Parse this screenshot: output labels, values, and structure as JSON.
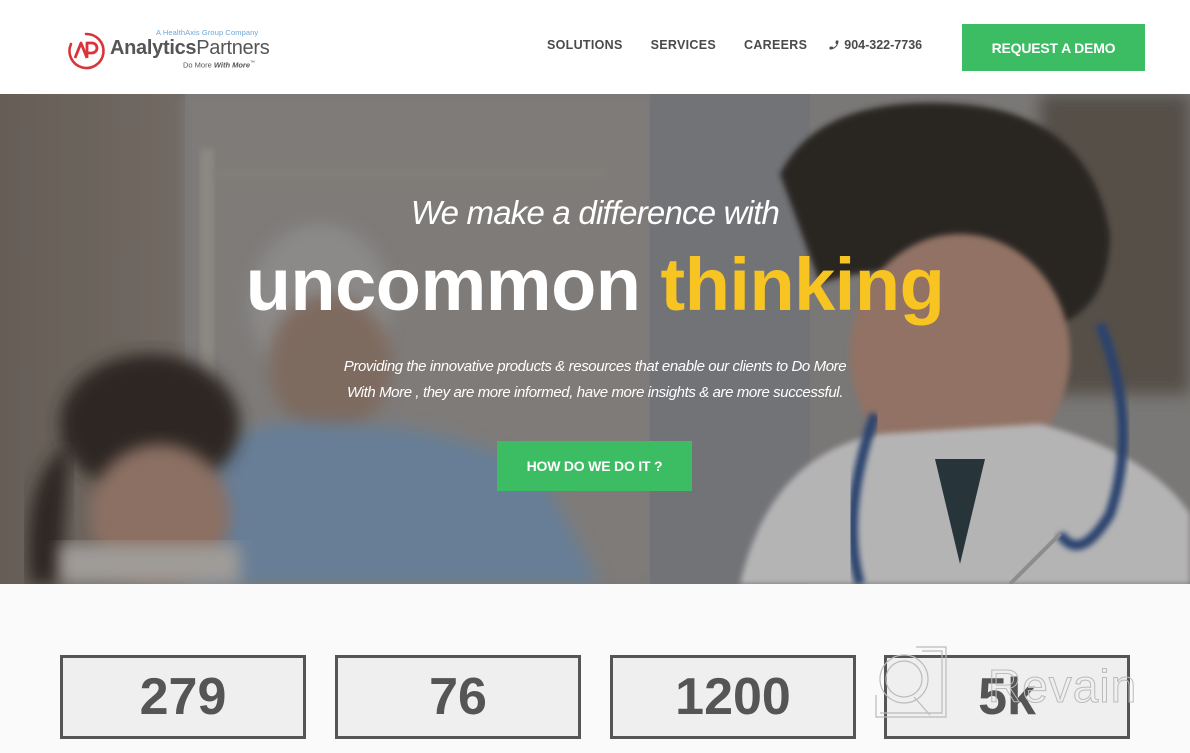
{
  "header": {
    "logo": {
      "tagline_top": "A HealthAxis Group Company",
      "name_bold": "Analytics",
      "name_regular": "Partners",
      "tagline_bottom_regular": "Do More ",
      "tagline_bottom_bold": "With More",
      "tagline_bottom_mark": "™",
      "mark_text": "AP",
      "mark_color": "#d9343a"
    },
    "nav": [
      {
        "label": "SOLUTIONS"
      },
      {
        "label": "SERVICES"
      },
      {
        "label": "CAREERS"
      }
    ],
    "phone": {
      "icon": "phone-icon",
      "number": "904-322-7736"
    },
    "demo_button": "REQUEST A DEMO"
  },
  "hero": {
    "subtitle": "We make a difference with",
    "title_main": "uncommon",
    "title_accent": "thinking",
    "description_line1": "Providing the innovative products & resources that enable our clients to Do More",
    "description_line2": "With More , they are more informed, have more insights & are more successful.",
    "cta_button": "HOW DO WE DO IT ?",
    "accent_color": "#f8c422"
  },
  "stats": [
    {
      "value": "279"
    },
    {
      "value": "76"
    },
    {
      "value": "1200"
    },
    {
      "value": "5k"
    }
  ],
  "watermark": {
    "text": "Revain"
  },
  "colors": {
    "primary_green": "#3cbd63",
    "text_dark": "#555555"
  }
}
